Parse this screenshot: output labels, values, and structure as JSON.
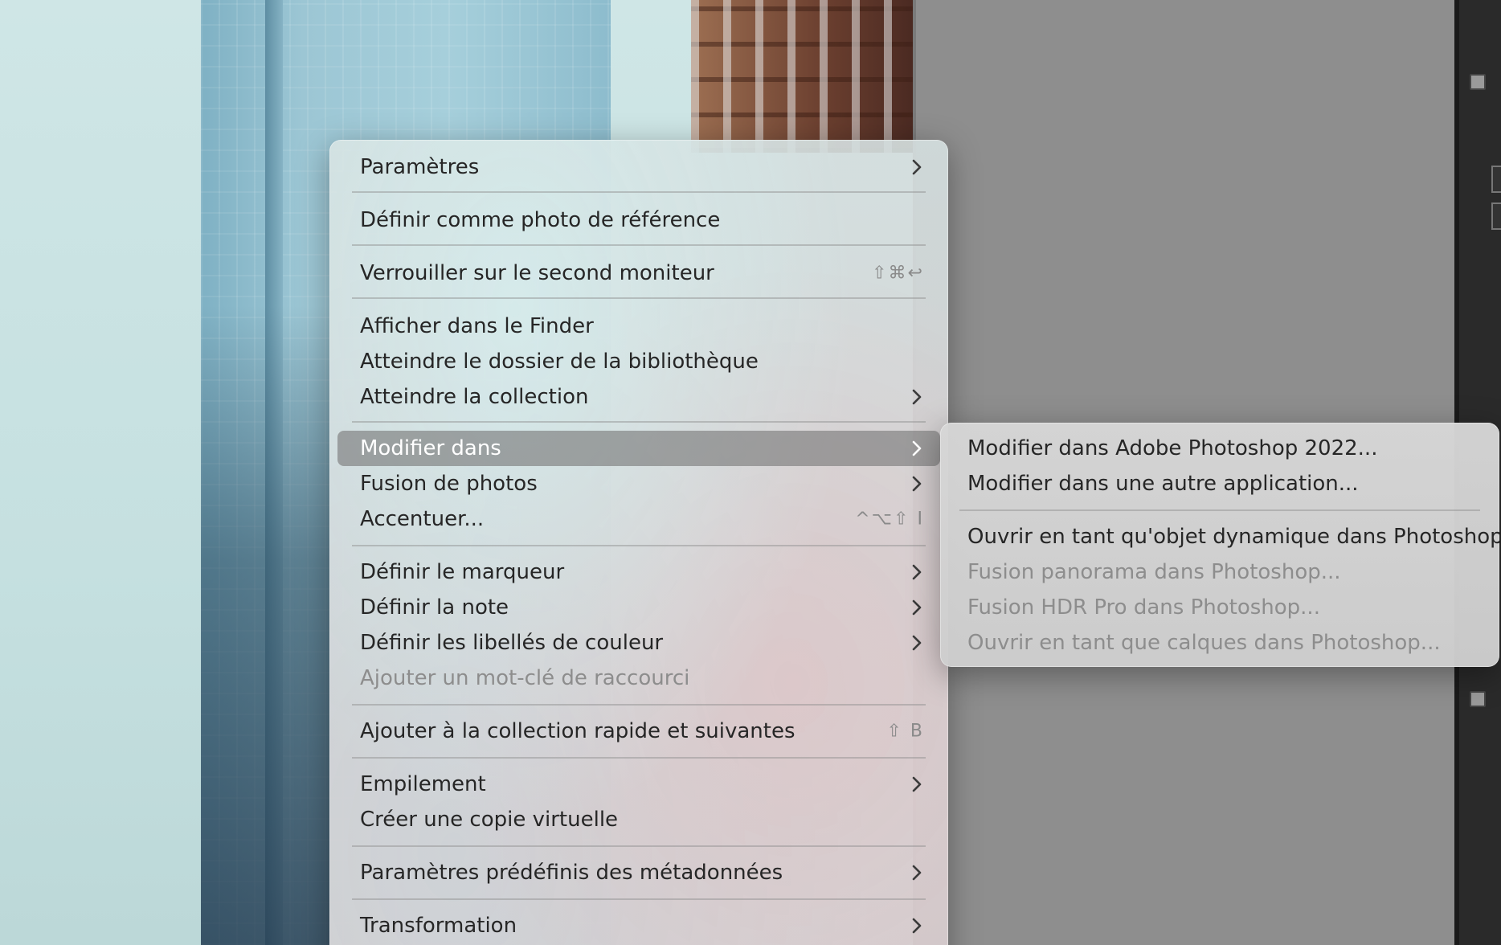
{
  "context_menu": {
    "items": [
      {
        "label": "Paramètres",
        "submenu": true
      },
      {
        "label": "Définir comme photo de référence"
      },
      {
        "label": "Verrouiller sur le second moniteur",
        "shortcut": "⇧⌘↩"
      },
      {
        "label": "Afficher dans le Finder"
      },
      {
        "label": "Atteindre le dossier de la bibliothèque"
      },
      {
        "label": "Atteindre la collection",
        "submenu": true
      },
      {
        "label": "Modifier dans",
        "submenu": true,
        "selected": true
      },
      {
        "label": "Fusion de photos",
        "submenu": true
      },
      {
        "label": "Accentuer...",
        "shortcut": "^⌥⇧ I"
      },
      {
        "label": "Définir le marqueur",
        "submenu": true
      },
      {
        "label": "Définir la note",
        "submenu": true
      },
      {
        "label": "Définir les libellés de couleur",
        "submenu": true
      },
      {
        "label": "Ajouter un mot-clé de raccourci",
        "disabled": true
      },
      {
        "label": "Ajouter à la collection rapide et suivantes",
        "shortcut": "⇧ B"
      },
      {
        "label": "Empilement",
        "submenu": true
      },
      {
        "label": "Créer une copie virtuelle"
      },
      {
        "label": "Paramètres prédéfinis des métadonnées",
        "submenu": true
      },
      {
        "label": "Transformation",
        "submenu": true
      }
    ]
  },
  "submenu": {
    "items": [
      {
        "label": "Modifier dans Adobe Photoshop 2022..."
      },
      {
        "label": "Modifier dans une autre application..."
      },
      {
        "label": "Ouvrir en tant qu'objet dynamique dans Photoshop..."
      },
      {
        "label": "Fusion panorama dans Photoshop...",
        "disabled": true
      },
      {
        "label": "Fusion HDR Pro dans Photoshop...",
        "disabled": true
      },
      {
        "label": "Ouvrir en tant que calques dans Photoshop...",
        "disabled": true
      }
    ]
  },
  "colors": {
    "menu_text": "#262626",
    "disabled_text": "#8d8d8d",
    "selected_background": "#787878",
    "selected_text": "#ffffff"
  },
  "icons": {
    "submenu_indicator": "chevron-right-icon"
  }
}
